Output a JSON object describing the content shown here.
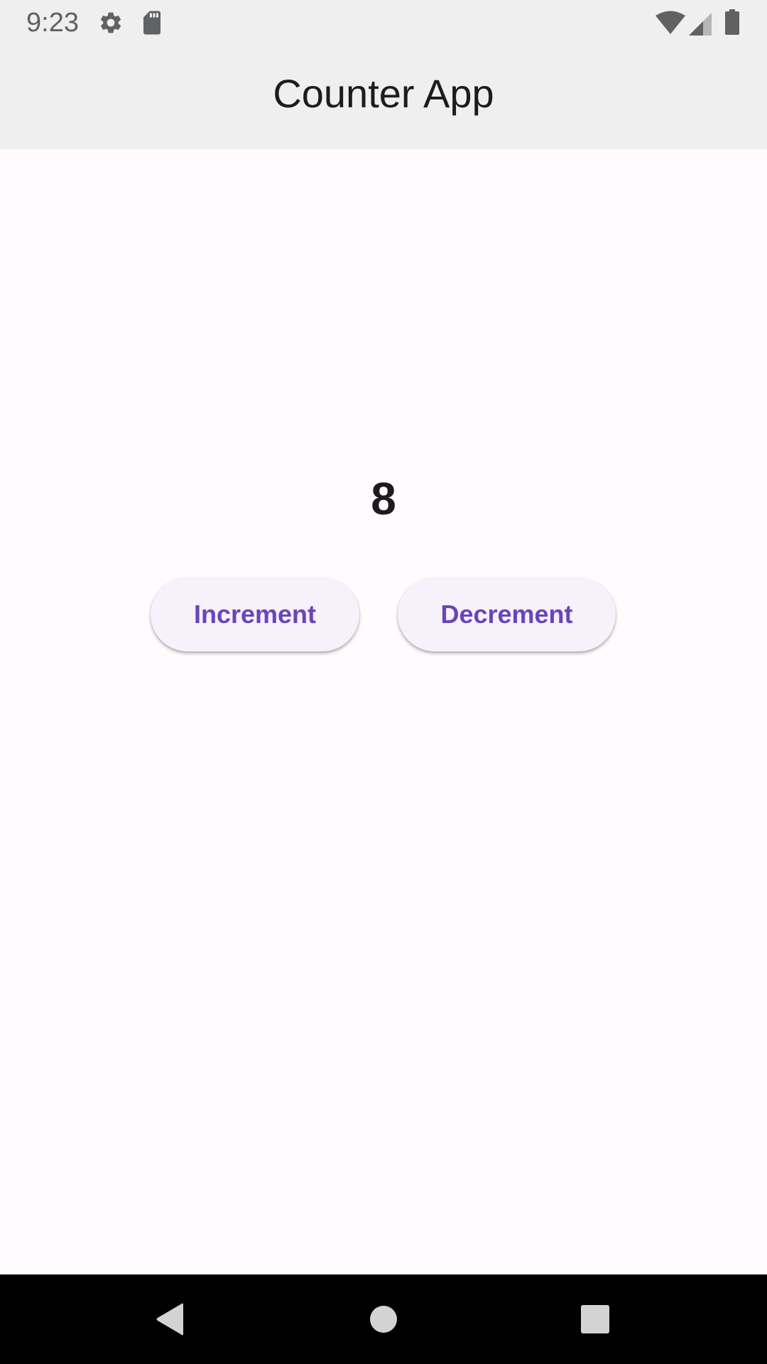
{
  "status_bar": {
    "time": "9:23",
    "icons": [
      "gear-icon",
      "sd-card-icon",
      "wifi-icon",
      "signal-icon",
      "battery-icon"
    ]
  },
  "app_bar": {
    "title": "Counter App"
  },
  "counter": {
    "value": "8"
  },
  "buttons": {
    "increment_label": "Increment",
    "decrement_label": "Decrement"
  },
  "navigation": {
    "icons": [
      "back-icon",
      "home-icon",
      "recents-icon"
    ]
  },
  "colors": {
    "accent": "#6a45b9",
    "app_bar_background": "#eeefee",
    "page_background": "#fffbfe",
    "button_background": "#f6f1fa",
    "nav_bar_background": "#000000"
  }
}
